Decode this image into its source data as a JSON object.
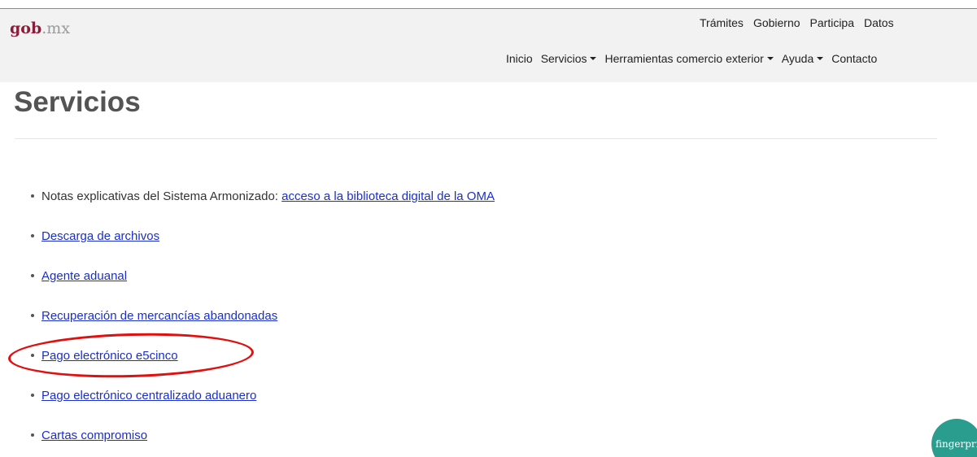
{
  "logo": {
    "brand": "gob",
    "separator": ".",
    "suffix": "mx"
  },
  "top_nav": [
    "Trámites",
    "Gobierno",
    "Participa",
    "Datos"
  ],
  "main_nav": [
    {
      "label": "Inicio",
      "dropdown": false
    },
    {
      "label": "Servicios",
      "dropdown": true
    },
    {
      "label": "Herramientas comercio exterior",
      "dropdown": true
    },
    {
      "label": "Ayuda",
      "dropdown": true
    },
    {
      "label": "Contacto",
      "dropdown": false
    }
  ],
  "page": {
    "title": "Servicios"
  },
  "services": {
    "first_prefix": "Notas explicativas del Sistema Armonizado:",
    "first_link": "acceso a la biblioteca digital de la OMA",
    "links": [
      "Descarga de archivos",
      "Agente aduanal",
      "Recuperación de mercancías abandonadas",
      "Pago electrónico e5cinco",
      "Pago electrónico centralizado aduanero",
      "Cartas compromiso"
    ]
  },
  "annotation": {
    "highlighted_item": "Pago electrónico e5cinco",
    "color": "#e01010"
  },
  "badge": {
    "label": "fingerpri",
    "color": "#2a9d8f"
  },
  "colors": {
    "brand": "#8b1c3a",
    "link": "#1a2fcc",
    "header_bg": "#f2f2f2"
  }
}
